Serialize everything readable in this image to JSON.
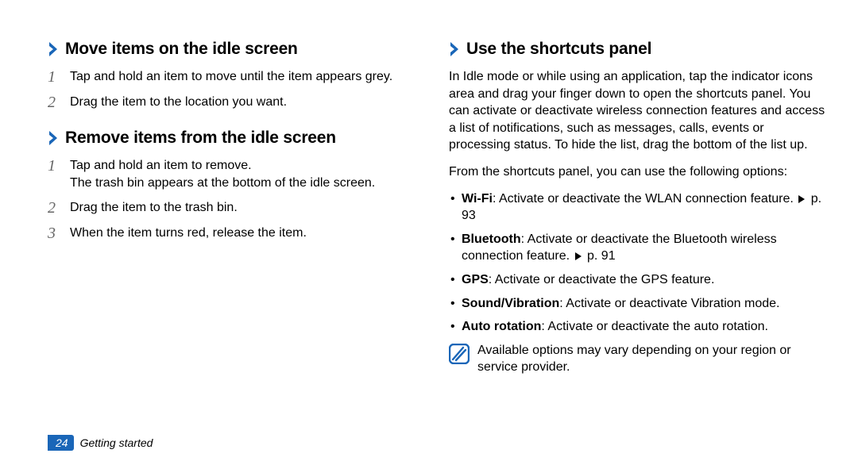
{
  "left": {
    "section1": {
      "heading": "Move items on the idle screen",
      "steps": [
        "Tap and hold an item to move until the item appears grey.",
        "Drag the item to the location you want."
      ]
    },
    "section2": {
      "heading": "Remove items from the idle screen",
      "steps": [
        "Tap and hold an item to remove.",
        "Drag the item to the trash bin.",
        "When the item turns red, release the item."
      ],
      "step1_extra": "The trash bin appears at the bottom of the idle screen."
    }
  },
  "right": {
    "heading": "Use the shortcuts panel",
    "para1": "In Idle mode or while using an application, tap the indicator icons area and drag your finger down to open the shortcuts panel. You can activate or deactivate wireless connection features and access a list of notifications, such as messages, calls, events or processing status. To hide the list, drag the bottom of the list up.",
    "para2": "From the shortcuts panel, you can use the following options:",
    "bullets": {
      "b0_bold": "Wi-Fi",
      "b0_text": ": Activate or deactivate the WLAN connection feature. ",
      "b0_page": "p. 93",
      "b1_bold": "Bluetooth",
      "b1_text": ": Activate or deactivate the Bluetooth wireless connection feature. ",
      "b1_page": "p. 91",
      "b2_bold": "GPS",
      "b2_text": ": Activate or deactivate the GPS feature.",
      "b3_bold": "Sound/Vibration",
      "b3_text": ": Activate or deactivate Vibration mode.",
      "b4_bold": "Auto rotation",
      "b4_text": ": Activate or deactivate the auto rotation."
    },
    "note": "Available options may vary depending on your region or service provider."
  },
  "footer": {
    "page": "24",
    "chapter": "Getting started"
  }
}
